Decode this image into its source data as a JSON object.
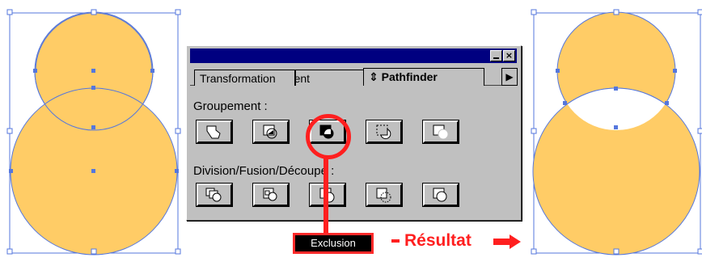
{
  "colors": {
    "shape_fill": "#ffcc66",
    "path_stroke": "#5577dd",
    "highlight": "#ff1f1f",
    "panel_bg": "#c0c0c0",
    "titlebar": "#000080"
  },
  "palette": {
    "tabs": [
      {
        "label": "Transformation"
      },
      {
        "label": "Alignement"
      },
      {
        "label": "Pathfinder",
        "prefix_icon": "⇕"
      }
    ],
    "groupement": {
      "label": "Groupement :",
      "buttons": [
        {
          "name": "unite-icon"
        },
        {
          "name": "intersection-icon"
        },
        {
          "name": "exclusion-icon"
        },
        {
          "name": "soustraction-avant-icon"
        },
        {
          "name": "soustraction-arriere-icon"
        }
      ]
    },
    "division": {
      "label": "Division/Fusion/Découpe :",
      "buttons": [
        {
          "name": "division-icon"
        },
        {
          "name": "fusion-icon"
        },
        {
          "name": "decoupe-icon"
        },
        {
          "name": "contour-icon"
        },
        {
          "name": "cadrage-icon"
        }
      ]
    }
  },
  "annotation": {
    "tooltip": "Exclusion",
    "result_label": "Résultat"
  }
}
